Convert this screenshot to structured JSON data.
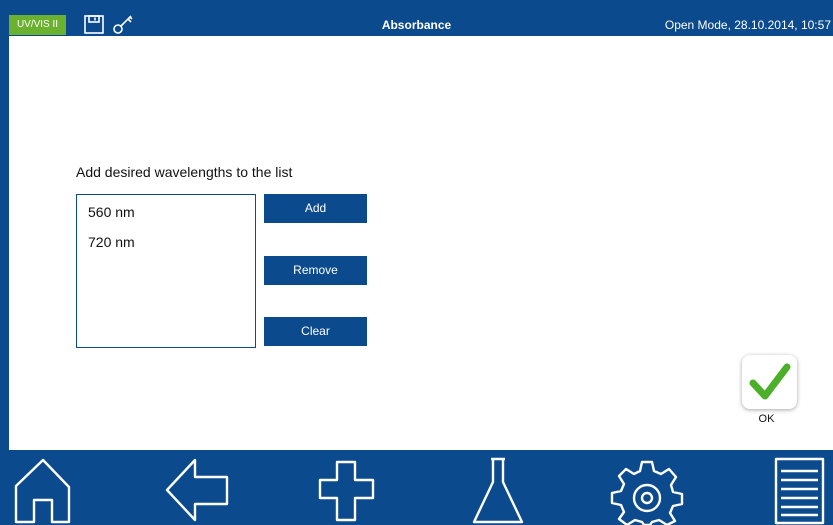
{
  "header": {
    "mode_badge": "UV/VIS II",
    "title": "Absorbance",
    "status": "Open Mode, 28.10.2014, 10:57",
    "icons": [
      "save-icon",
      "key-icon"
    ]
  },
  "main": {
    "instruction": "Add desired wavelengths to the list",
    "wavelengths": [
      "560 nm",
      "720 nm"
    ],
    "buttons": {
      "add": "Add",
      "remove": "Remove",
      "clear": "Clear"
    },
    "ok_label": "OK"
  },
  "navbar": {
    "icons": [
      "home-icon",
      "back-arrow-icon",
      "add-plus-icon",
      "flask-icon",
      "gear-icon",
      "list-menu-icon"
    ]
  },
  "colors": {
    "primary": "#0b4a8c",
    "badge": "#6ab12f",
    "ok_check": "#4caf2a"
  }
}
